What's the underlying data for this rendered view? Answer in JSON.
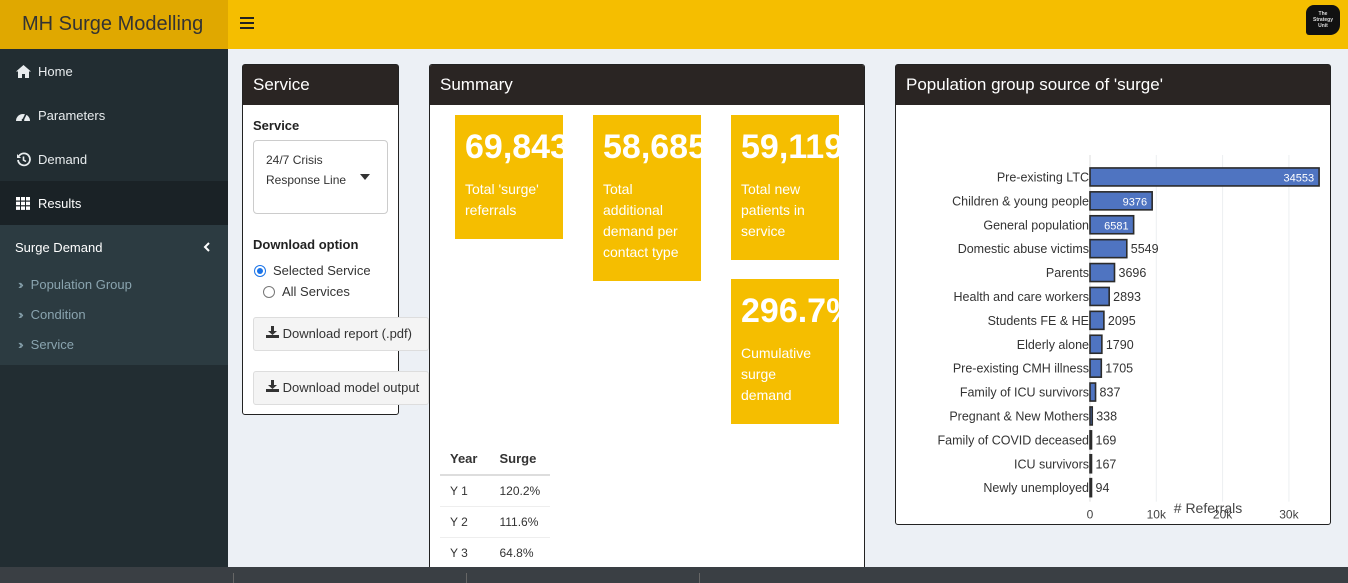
{
  "app": {
    "title": "MH Surge Modelling"
  },
  "header": {
    "menu_icon": "hamburger-icon",
    "brand_badge_lines": [
      "The",
      "Strategy",
      "Unit"
    ]
  },
  "sidebar": {
    "items": [
      {
        "label": "Home",
        "icon": "home-icon"
      },
      {
        "label": "Parameters",
        "icon": "dashboard-icon"
      },
      {
        "label": "Demand",
        "icon": "history-icon"
      },
      {
        "label": "Results",
        "icon": "table-icon",
        "active": true
      }
    ],
    "group": {
      "label": "Surge Demand",
      "icon": "chevron-left-icon"
    },
    "sub_items": [
      {
        "label": "Population Group"
      },
      {
        "label": "Condition"
      },
      {
        "label": "Service"
      }
    ]
  },
  "service_box": {
    "title": "Service",
    "service_label": "Service",
    "selected_service_line1": "24/7 Crisis",
    "selected_service_line2": "Response Line",
    "download_option_label": "Download option",
    "radio_selected": "Selected Service",
    "radio_all": "All Services",
    "download_report": "Download report (.pdf)",
    "download_model": "Download model output"
  },
  "summary_box": {
    "title": "Summary",
    "values": [
      {
        "value": "69,843",
        "caption": "Total 'surge' referrals"
      },
      {
        "value": "58,685",
        "caption": "Total additional demand per contact type"
      },
      {
        "value": "59,119",
        "caption": "Total new patients in service"
      },
      {
        "value": "296.7%",
        "caption": "Cumulative surge demand"
      }
    ],
    "table": {
      "headers": [
        "Year",
        "Surge"
      ],
      "rows": [
        [
          "Y 1",
          "120.2%"
        ],
        [
          "Y 2",
          "111.6%"
        ],
        [
          "Y 3",
          "64.8%"
        ]
      ]
    }
  },
  "chart_box": {
    "title": "Population group source of 'surge'"
  },
  "chart_data": {
    "type": "bar",
    "orientation": "horizontal",
    "categories": [
      "Pre-existing LTC",
      "Children & young people",
      "General population",
      "Domestic abuse victims",
      "Parents",
      "Health and care workers",
      "Students FE & HE",
      "Elderly alone",
      "Pre-existing CMH illness",
      "Family of ICU survivors",
      "Pregnant & New Mothers",
      "Family of COVID deceased",
      "ICU survivors",
      "Newly unemployed"
    ],
    "values": [
      34553,
      9376,
      6581,
      5549,
      3696,
      2893,
      2095,
      1790,
      1705,
      837,
      338,
      169,
      167,
      94
    ],
    "data_labels": [
      "34553",
      "9376",
      "6581",
      "5549",
      "3696",
      "2893",
      "2095",
      "1790",
      "1705",
      "837",
      "338",
      "169",
      "167",
      "94"
    ],
    "xlabel": "# Referrals",
    "xticks": [
      0,
      10000,
      20000,
      30000
    ],
    "xtick_labels": [
      "0",
      "10k",
      "20k",
      "30k"
    ],
    "xlim": [
      0,
      36500
    ],
    "bar_color": "#4f74c1",
    "grid": true
  }
}
